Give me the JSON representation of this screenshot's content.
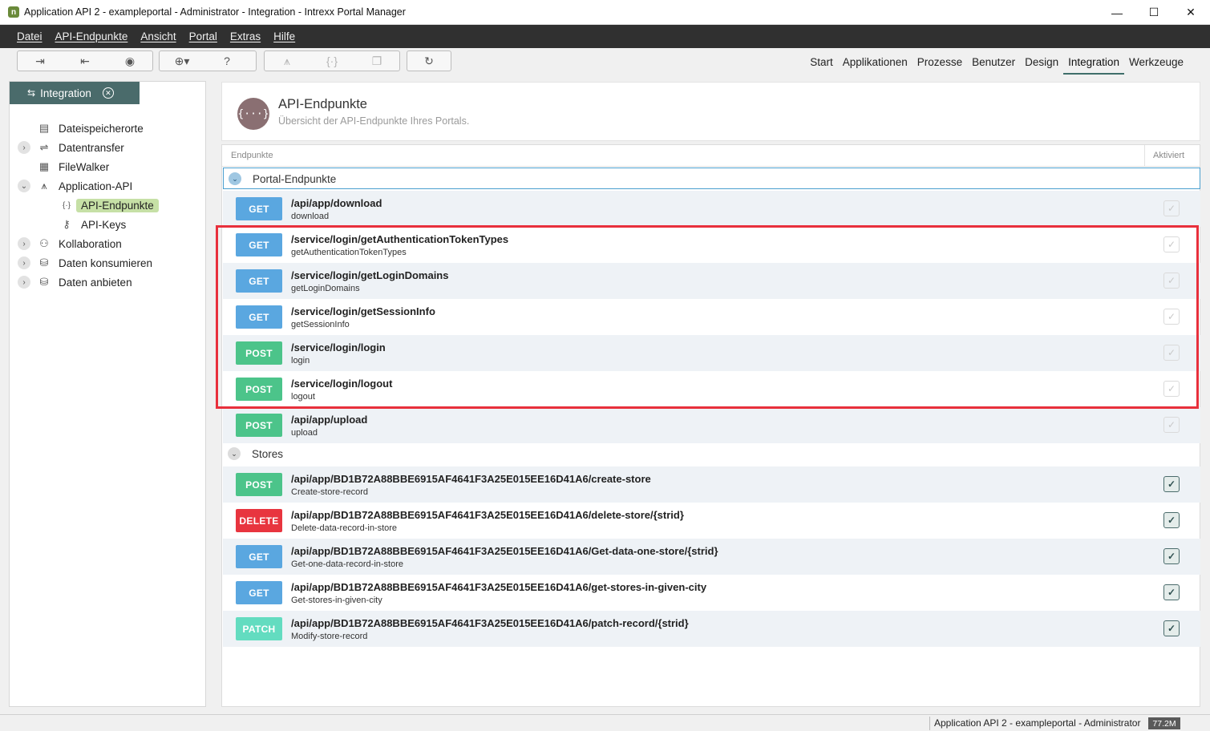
{
  "window": {
    "title": "Application API 2 - exampleportal - Administrator - Integration - Intrexx Portal Manager",
    "icon_letter": "n",
    "minimize_glyph": "—",
    "maximize_glyph": "☐",
    "close_glyph": "✕"
  },
  "menu": [
    "Datei",
    "API-Endpunkte",
    "Ansicht",
    "Portal",
    "Extras",
    "Hilfe"
  ],
  "toolbar": {
    "icons": [
      "import-icon",
      "export-icon",
      "globe-icon",
      "globe-dropdown-icon",
      "help-icon",
      "api-icon",
      "braces-icon",
      "copy-icon",
      "refresh-icon"
    ]
  },
  "top_tabs": {
    "items": [
      "Start",
      "Applikationen",
      "Prozesse",
      "Benutzer",
      "Design",
      "Integration",
      "Werkzeuge"
    ],
    "active": "Integration"
  },
  "left_panel": {
    "tab_label": "Integration",
    "tree": [
      {
        "label": "Dateispeicherorte",
        "icon": "file-storage-icon",
        "expander": ""
      },
      {
        "label": "Datentransfer",
        "icon": "data-transfer-icon",
        "expander": "›"
      },
      {
        "label": "FileWalker",
        "icon": "filewalker-icon",
        "expander": ""
      },
      {
        "label": "Application-API",
        "icon": "application-api-icon",
        "expander": "⌄"
      },
      {
        "label": "API-Endpunkte",
        "icon": "braces-icon",
        "expander": "",
        "selected": true
      },
      {
        "label": "API-Keys",
        "icon": "key-icon",
        "expander": ""
      },
      {
        "label": "Kollaboration",
        "icon": "collaboration-icon",
        "expander": "›"
      },
      {
        "label": "Daten konsumieren",
        "icon": "database-consume-icon",
        "expander": "›"
      },
      {
        "label": "Daten anbieten",
        "icon": "database-provide-icon",
        "expander": "›"
      }
    ]
  },
  "header": {
    "icon_text": "{···}",
    "title": "API-Endpunkte",
    "subtitle": "Übersicht der API-Endpunkte Ihres Portals."
  },
  "table": {
    "col_endpoints": "Endpunkte",
    "col_active": "Aktiviert",
    "groups": [
      {
        "label": "Portal-Endpunkte",
        "endpoints": [
          {
            "method": "GET",
            "path": "/api/app/download",
            "desc": "download",
            "active": false
          },
          {
            "method": "GET",
            "path": "/service/login/getAuthenticationTokenTypes",
            "desc": "getAuthenticationTokenTypes",
            "active": false
          },
          {
            "method": "GET",
            "path": "/service/login/getLoginDomains",
            "desc": "getLoginDomains",
            "active": false
          },
          {
            "method": "GET",
            "path": "/service/login/getSessionInfo",
            "desc": "getSessionInfo",
            "active": false
          },
          {
            "method": "POST",
            "path": "/service/login/login",
            "desc": "login",
            "active": false
          },
          {
            "method": "POST",
            "path": "/service/login/logout",
            "desc": "logout",
            "active": false
          },
          {
            "method": "POST",
            "path": "/api/app/upload",
            "desc": "upload",
            "active": false
          }
        ]
      },
      {
        "label": "Stores",
        "endpoints": [
          {
            "method": "POST",
            "path": "/api/app/BD1B72A88BBE6915AF4641F3A25E015EE16D41A6/create-store",
            "desc": "Create-store-record",
            "active": true
          },
          {
            "method": "DELETE",
            "path": "/api/app/BD1B72A88BBE6915AF4641F3A25E015EE16D41A6/delete-store/{strid}",
            "desc": "Delete-data-record-in-store",
            "active": true
          },
          {
            "method": "GET",
            "path": "/api/app/BD1B72A88BBE6915AF4641F3A25E015EE16D41A6/Get-data-one-store/{strid}",
            "desc": "Get-one-data-record-in-store",
            "active": true
          },
          {
            "method": "GET",
            "path": "/api/app/BD1B72A88BBE6915AF4641F3A25E015EE16D41A6/get-stores-in-given-city",
            "desc": "Get-stores-in-given-city",
            "active": true
          },
          {
            "method": "PATCH",
            "path": "/api/app/BD1B72A88BBE6915AF4641F3A25E015EE16D41A6/patch-record/{strid}",
            "desc": "Modify-store-record",
            "active": true
          }
        ]
      }
    ]
  },
  "method_colors": {
    "GET": "#5aa7e0",
    "POST": "#4cc48a",
    "DELETE": "#e8353f",
    "PATCH": "#63dcc0"
  },
  "check_glyph": "✓",
  "status": {
    "text": "Application API 2 - exampleportal - Administrator",
    "memory": "77.2M"
  }
}
